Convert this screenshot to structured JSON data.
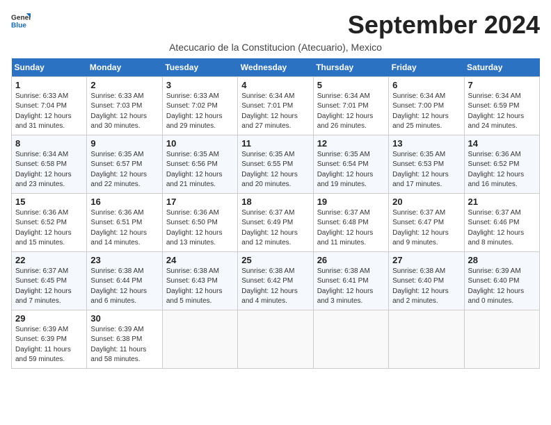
{
  "logo": {
    "line1": "General",
    "line2": "Blue"
  },
  "title": "September 2024",
  "subtitle": "Atecucario de la Constitucion (Atecuario), Mexico",
  "days_of_week": [
    "Sunday",
    "Monday",
    "Tuesday",
    "Wednesday",
    "Thursday",
    "Friday",
    "Saturday"
  ],
  "weeks": [
    [
      {
        "day": "1",
        "sunrise": "6:33 AM",
        "sunset": "7:04 PM",
        "daylight": "12 hours and 31 minutes."
      },
      {
        "day": "2",
        "sunrise": "6:33 AM",
        "sunset": "7:03 PM",
        "daylight": "12 hours and 30 minutes."
      },
      {
        "day": "3",
        "sunrise": "6:33 AM",
        "sunset": "7:02 PM",
        "daylight": "12 hours and 29 minutes."
      },
      {
        "day": "4",
        "sunrise": "6:34 AM",
        "sunset": "7:01 PM",
        "daylight": "12 hours and 27 minutes."
      },
      {
        "day": "5",
        "sunrise": "6:34 AM",
        "sunset": "7:01 PM",
        "daylight": "12 hours and 26 minutes."
      },
      {
        "day": "6",
        "sunrise": "6:34 AM",
        "sunset": "7:00 PM",
        "daylight": "12 hours and 25 minutes."
      },
      {
        "day": "7",
        "sunrise": "6:34 AM",
        "sunset": "6:59 PM",
        "daylight": "12 hours and 24 minutes."
      }
    ],
    [
      {
        "day": "8",
        "sunrise": "6:34 AM",
        "sunset": "6:58 PM",
        "daylight": "12 hours and 23 minutes."
      },
      {
        "day": "9",
        "sunrise": "6:35 AM",
        "sunset": "6:57 PM",
        "daylight": "12 hours and 22 minutes."
      },
      {
        "day": "10",
        "sunrise": "6:35 AM",
        "sunset": "6:56 PM",
        "daylight": "12 hours and 21 minutes."
      },
      {
        "day": "11",
        "sunrise": "6:35 AM",
        "sunset": "6:55 PM",
        "daylight": "12 hours and 20 minutes."
      },
      {
        "day": "12",
        "sunrise": "6:35 AM",
        "sunset": "6:54 PM",
        "daylight": "12 hours and 19 minutes."
      },
      {
        "day": "13",
        "sunrise": "6:35 AM",
        "sunset": "6:53 PM",
        "daylight": "12 hours and 17 minutes."
      },
      {
        "day": "14",
        "sunrise": "6:36 AM",
        "sunset": "6:52 PM",
        "daylight": "12 hours and 16 minutes."
      }
    ],
    [
      {
        "day": "15",
        "sunrise": "6:36 AM",
        "sunset": "6:52 PM",
        "daylight": "12 hours and 15 minutes."
      },
      {
        "day": "16",
        "sunrise": "6:36 AM",
        "sunset": "6:51 PM",
        "daylight": "12 hours and 14 minutes."
      },
      {
        "day": "17",
        "sunrise": "6:36 AM",
        "sunset": "6:50 PM",
        "daylight": "12 hours and 13 minutes."
      },
      {
        "day": "18",
        "sunrise": "6:37 AM",
        "sunset": "6:49 PM",
        "daylight": "12 hours and 12 minutes."
      },
      {
        "day": "19",
        "sunrise": "6:37 AM",
        "sunset": "6:48 PM",
        "daylight": "12 hours and 11 minutes."
      },
      {
        "day": "20",
        "sunrise": "6:37 AM",
        "sunset": "6:47 PM",
        "daylight": "12 hours and 9 minutes."
      },
      {
        "day": "21",
        "sunrise": "6:37 AM",
        "sunset": "6:46 PM",
        "daylight": "12 hours and 8 minutes."
      }
    ],
    [
      {
        "day": "22",
        "sunrise": "6:37 AM",
        "sunset": "6:45 PM",
        "daylight": "12 hours and 7 minutes."
      },
      {
        "day": "23",
        "sunrise": "6:38 AM",
        "sunset": "6:44 PM",
        "daylight": "12 hours and 6 minutes."
      },
      {
        "day": "24",
        "sunrise": "6:38 AM",
        "sunset": "6:43 PM",
        "daylight": "12 hours and 5 minutes."
      },
      {
        "day": "25",
        "sunrise": "6:38 AM",
        "sunset": "6:42 PM",
        "daylight": "12 hours and 4 minutes."
      },
      {
        "day": "26",
        "sunrise": "6:38 AM",
        "sunset": "6:41 PM",
        "daylight": "12 hours and 3 minutes."
      },
      {
        "day": "27",
        "sunrise": "6:38 AM",
        "sunset": "6:40 PM",
        "daylight": "12 hours and 2 minutes."
      },
      {
        "day": "28",
        "sunrise": "6:39 AM",
        "sunset": "6:40 PM",
        "daylight": "12 hours and 0 minutes."
      }
    ],
    [
      {
        "day": "29",
        "sunrise": "6:39 AM",
        "sunset": "6:39 PM",
        "daylight": "11 hours and 59 minutes."
      },
      {
        "day": "30",
        "sunrise": "6:39 AM",
        "sunset": "6:38 PM",
        "daylight": "11 hours and 58 minutes."
      },
      null,
      null,
      null,
      null,
      null
    ]
  ]
}
